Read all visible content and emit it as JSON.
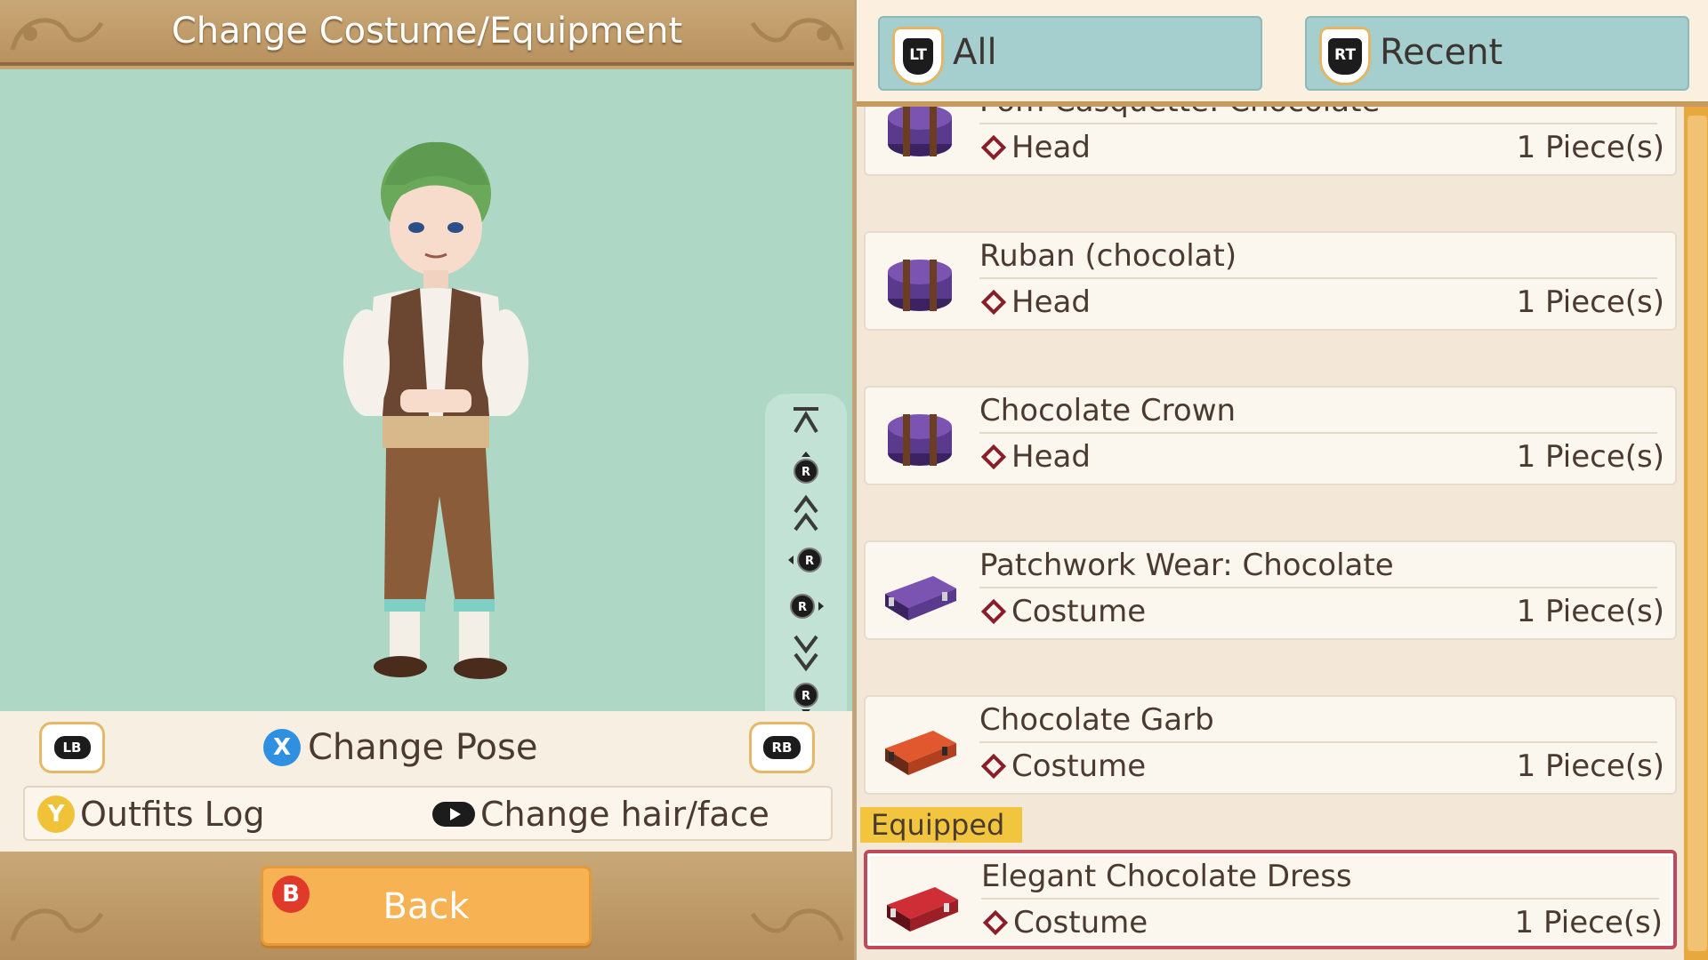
{
  "left_panel": {
    "title": "Change Costume/Equipment",
    "shoulder_left": "LB",
    "shoulder_right": "RB",
    "change_pose": {
      "button": "X",
      "label": "Change Pose"
    },
    "outfits_log": {
      "button": "Y",
      "label": "Outfits Log"
    },
    "change_hair_face": {
      "label": "Change hair/face"
    },
    "back": {
      "button": "B",
      "label": "Back"
    },
    "camera_controls": [
      "jump-top-icon",
      "rotate-up-icon",
      "scroll-up-icon",
      "rotate-left-icon",
      "rotate-right-icon",
      "scroll-down-icon",
      "rotate-down-icon",
      "jump-bottom-icon"
    ]
  },
  "tabs": [
    {
      "button": "LT",
      "label": "All"
    },
    {
      "button": "RT",
      "label": "Recent"
    }
  ],
  "items": [
    {
      "name": "Pom Casquette: Chocolate",
      "type": "Head",
      "qty": "1 Piece(s)",
      "icon": "hatbox-purple-icon"
    },
    {
      "name": "Ruban (chocolat)",
      "type": "Head",
      "qty": "1 Piece(s)",
      "icon": "hatbox-purple-icon"
    },
    {
      "name": "Chocolate Crown",
      "type": "Head",
      "qty": "1 Piece(s)",
      "icon": "hatbox-purple-icon"
    },
    {
      "name": "Patchwork Wear: Chocolate",
      "type": "Costume",
      "qty": "1 Piece(s)",
      "icon": "suitcase-purple-icon"
    },
    {
      "name": "Chocolate Garb",
      "type": "Costume",
      "qty": "1 Piece(s)",
      "icon": "suitcase-orange-icon"
    },
    {
      "name": "Elegant Chocolate Dress",
      "type": "Costume",
      "qty": "1 Piece(s)",
      "icon": "suitcase-red-icon",
      "equipped_label": "Equipped"
    }
  ],
  "colors": {
    "accent": "#f6b253",
    "tab": "#a5cfcf",
    "preview_bg": "#afd7c6",
    "equipped": "#c04a5c"
  }
}
